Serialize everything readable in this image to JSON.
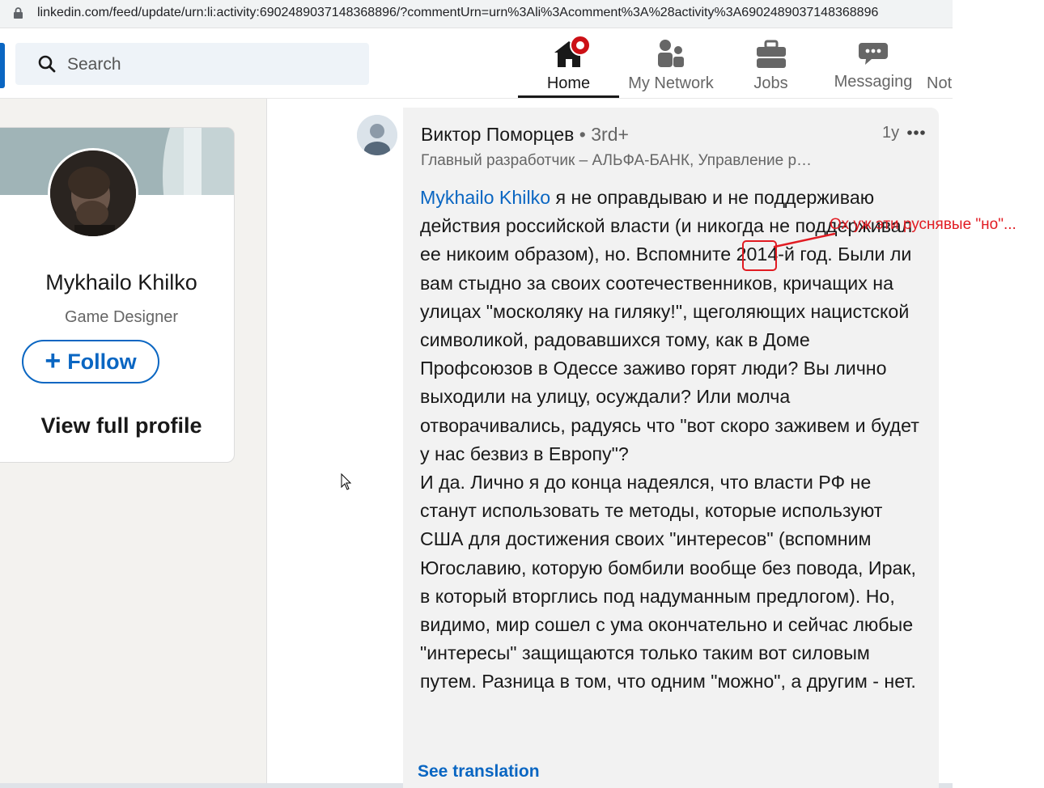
{
  "browser": {
    "url": "linkedin.com/feed/update/urn:li:activity:6902489037148368896/?commentUrn=urn%3Ali%3Acomment%3A%28activity%3A6902489037148368896"
  },
  "nav": {
    "search_placeholder": "Search",
    "items": [
      {
        "label": "Home",
        "icon": "home-icon",
        "active": true
      },
      {
        "label": "My Network",
        "icon": "network-icon"
      },
      {
        "label": "Jobs",
        "icon": "briefcase-icon"
      },
      {
        "label": "Messaging",
        "icon": "messaging-icon"
      },
      {
        "label": "Not",
        "icon": "notifications-icon"
      }
    ]
  },
  "profile_card": {
    "name": "Mykhailo Khilko",
    "title": "Game Designer",
    "follow_label": "Follow",
    "view_profile_label": "View full profile"
  },
  "comment": {
    "author": "Виктор Поморцев",
    "degree": "• 3rd+",
    "headline": "Главный разработчик – АЛЬФА-БАНК, Управление р…",
    "time": "1y",
    "mention": "Mykhailo Khilko",
    "paragraph1": " я не оправдываю и не поддерживаю действия российской власти (и никогда не поддерживал ее никоим образом), но. Вспомните 2014-й год. Были ли вам стыдно за своих соотечественников, кричащих на улицах \"москоляку на гиляку!\", щеголяющих нацистской символикой, радовавшихся тому, как в Доме Профсоюзов в Одессе заживо горят люди? Вы лично выходили на улицу, осуждали? Или молча отворачивались, радуясь что \"вот скоро заживем и будет у нас безвиз в Европу\"?",
    "paragraph2": "И да. Лично я до конца надеялся, что власти РФ не станут использовать те методы, которые используют США для достижения своих \"интересов\" (вспомним Югославию, которую бомбили вообще без повода, Ирак, в который вторглись под надуманным предлогом). Но, видимо, мир сошел с ума окончательно и сейчас любые \"интересы\" защищаются только таким вот силовым путем. Разница в том, что одним \"можно\", а другим - нет.",
    "see_translation": "See translation"
  },
  "annotation": {
    "text": "Ох уж эти руснявые \"но\"...",
    "color": "#e11b22"
  },
  "colors": {
    "linkedin_blue": "#0a66c2",
    "notification_red": "#cc1016"
  }
}
